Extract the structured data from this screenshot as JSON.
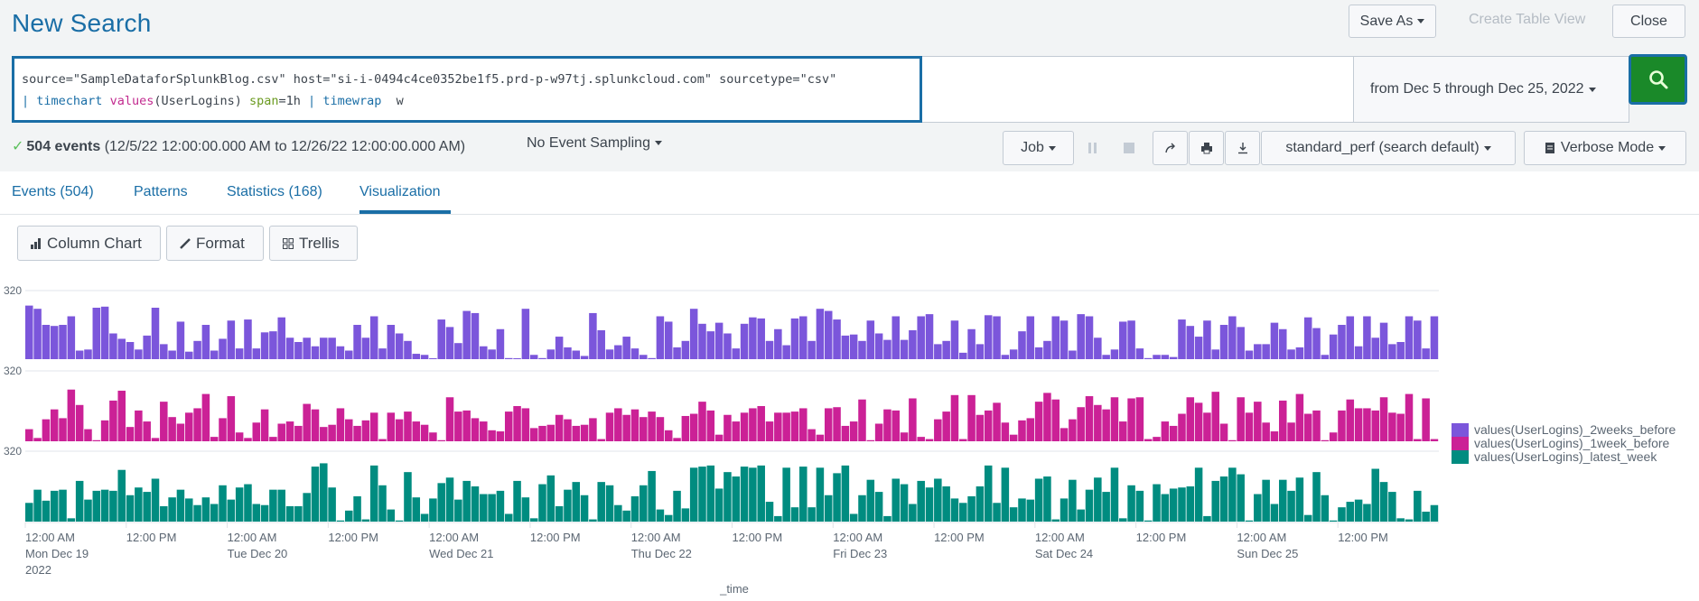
{
  "header": {
    "title": "New Search",
    "save_as_label": "Save As",
    "create_table_view_label": "Create Table View",
    "close_label": "Close"
  },
  "search": {
    "line1": {
      "source_key": "source=",
      "source_val": "\"SampleDataforSplunkBlog.csv\"",
      "host_key": " host=",
      "host_val": "\"si-i-0494c4ce0352be1f5.prd-p-w97tj.splunkcloud.com\"",
      "sourcetype_key": " sourcetype=",
      "sourcetype_val": "\"csv\""
    },
    "line2": {
      "pipe1": "| ",
      "cmd1": "timechart",
      "fn": "values",
      "fn_arg": "(UserLogins) ",
      "span_key": "span",
      "span_val": "=1h ",
      "pipe2": "| ",
      "cmd2": "timewrap",
      "cmd2_arg": "  w"
    },
    "time_range": "from Dec 5 through Dec 25, 2022",
    "search_icon": "magnifier-icon"
  },
  "status": {
    "check_icon": "✓",
    "events_count": "504 events",
    "range": "(12/5/22 12:00:00.000 AM to 12/26/22 12:00:00.000 AM)",
    "sampling": "No Event Sampling"
  },
  "job_controls": {
    "job_label": "Job",
    "pause_icon": "pause-icon",
    "stop_icon": "stop-icon",
    "share_icon": "share-icon",
    "print_icon": "print-icon",
    "export_icon": "export-icon",
    "perf_label": "standard_perf (search default)",
    "mode_label": "Verbose Mode"
  },
  "tabs": [
    {
      "label": "Events (504)",
      "active": false
    },
    {
      "label": "Patterns",
      "active": false
    },
    {
      "label": "Statistics (168)",
      "active": false
    },
    {
      "label": "Visualization",
      "active": true
    }
  ],
  "viz_buttons": {
    "chart_type": "Column Chart",
    "format": "Format",
    "trellis": "Trellis"
  },
  "colors": {
    "accent": "#1a6ea6",
    "go_button": "#1a8929",
    "series_2weeks": "#7b56db",
    "series_1week": "#cb2196",
    "series_latest": "#008c80"
  },
  "chart_data": {
    "type": "bar",
    "layout": "stacked-panels",
    "xlabel": "_time",
    "ylabel": "",
    "ylim": [
      0,
      320
    ],
    "y_tick_labels": [
      "320",
      "320",
      "320"
    ],
    "grid": true,
    "legend_position": "right",
    "x_ticks": [
      {
        "hour": 0,
        "line1": "12:00 AM",
        "line2": "Mon Dec 19",
        "line3": "2022"
      },
      {
        "hour": 12,
        "line1": "12:00 PM",
        "line2": "",
        "line3": ""
      },
      {
        "hour": 24,
        "line1": "12:00 AM",
        "line2": "Tue Dec 20",
        "line3": ""
      },
      {
        "hour": 36,
        "line1": "12:00 PM",
        "line2": "",
        "line3": ""
      },
      {
        "hour": 48,
        "line1": "12:00 AM",
        "line2": "Wed Dec 21",
        "line3": ""
      },
      {
        "hour": 60,
        "line1": "12:00 PM",
        "line2": "",
        "line3": ""
      },
      {
        "hour": 72,
        "line1": "12:00 AM",
        "line2": "Thu Dec 22",
        "line3": ""
      },
      {
        "hour": 84,
        "line1": "12:00 PM",
        "line2": "",
        "line3": ""
      },
      {
        "hour": 96,
        "line1": "12:00 AM",
        "line2": "Fri Dec 23",
        "line3": ""
      },
      {
        "hour": 108,
        "line1": "12:00 PM",
        "line2": "",
        "line3": ""
      },
      {
        "hour": 120,
        "line1": "12:00 AM",
        "line2": "Sat Dec 24",
        "line3": ""
      },
      {
        "hour": 132,
        "line1": "12:00 PM",
        "line2": "",
        "line3": ""
      },
      {
        "hour": 144,
        "line1": "12:00 AM",
        "line2": "Sun Dec 25",
        "line3": ""
      },
      {
        "hour": 156,
        "line1": "12:00 PM",
        "line2": "",
        "line3": ""
      }
    ],
    "series": [
      {
        "name": "values(UserLogins)_2weeks_before",
        "color": "#7b56db",
        "values": [
          250,
          235,
          160,
          155,
          160,
          200,
          40,
          45,
          240,
          245,
          120,
          95,
          80,
          45,
          110,
          240,
          70,
          40,
          175,
          35,
          85,
          160,
          40,
          95,
          180,
          50,
          185,
          50,
          125,
          130,
          195,
          100,
          80,
          100,
          60,
          100,
          100,
          60,
          40,
          160,
          100,
          200,
          50,
          160,
          120,
          85,
          25,
          20,
          2,
          185,
          150,
          75,
          225,
          215,
          60,
          45,
          140,
          5,
          2,
          235,
          20,
          5,
          45,
          105,
          55,
          40,
          15,
          215,
          135,
          45,
          65,
          105,
          50,
          20,
          5,
          200,
          175,
          55,
          85,
          235,
          165,
          130,
          170,
          120,
          50,
          165,
          195,
          190,
          85,
          140,
          65,
          190,
          200,
          85,
          235,
          225,
          185,
          110,
          115,
          85,
          180,
          120,
          90,
          200,
          90,
          135,
          200,
          210,
          70,
          85,
          180,
          30,
          140,
          70,
          205,
          200,
          20,
          45,
          130,
          200,
          55,
          85,
          200,
          180,
          40,
          210,
          200,
          100,
          20,
          45,
          175,
          180,
          50,
          5,
          20,
          20,
          10,
          185,
          155,
          105,
          180,
          45,
          160,
          200,
          150,
          40,
          70,
          70,
          170,
          140,
          45,
          55,
          195,
          145,
          20,
          115,
          160,
          200,
          60,
          200,
          100,
          170,
          70,
          80,
          200,
          180,
          50,
          200
        ]
      },
      {
        "name": "values(UserLogins)_1week_before",
        "color": "#cb2196",
        "values": [
          55,
          15,
          100,
          145,
          105,
          235,
          165,
          55,
          5,
          95,
          185,
          230,
          65,
          140,
          90,
          15,
          180,
          110,
          80,
          130,
          150,
          215,
          20,
          105,
          205,
          40,
          15,
          85,
          145,
          20,
          80,
          90,
          70,
          170,
          145,
          65,
          75,
          150,
          100,
          70,
          95,
          130,
          10,
          130,
          100,
          135,
          90,
          75,
          40,
          5,
          200,
          135,
          140,
          105,
          90,
          50,
          45,
          135,
          160,
          150,
          60,
          70,
          75,
          120,
          100,
          70,
          75,
          105,
          10,
          130,
          150,
          120,
          145,
          110,
          135,
          110,
          50,
          15,
          115,
          125,
          180,
          140,
          30,
          120,
          90,
          130,
          150,
          160,
          90,
          130,
          130,
          135,
          150,
          55,
          30,
          150,
          155,
          70,
          90,
          190,
          5,
          80,
          145,
          140,
          40,
          195,
          20,
          10,
          100,
          135,
          210,
          10,
          210,
          120,
          140,
          175,
          85,
          30,
          95,
          105,
          180,
          220,
          190,
          60,
          100,
          155,
          205,
          165,
          145,
          200,
          90,
          195,
          200,
          10,
          20,
          90,
          70,
          125,
          200,
          175,
          130,
          225,
          80,
          5,
          200,
          130,
          180,
          85,
          45,
          185,
          85,
          215,
          125,
          140,
          5,
          40,
          140,
          190,
          150,
          150,
          140,
          200,
          130,
          125,
          215,
          10,
          195,
          10
        ]
      },
      {
        "name": "values(UserLogins)_latest_week",
        "color": "#008c80",
        "values": [
          85,
          145,
          95,
          140,
          145,
          15,
          185,
          100,
          140,
          145,
          140,
          235,
          120,
          155,
          135,
          195,
          70,
          110,
          145,
          105,
          75,
          110,
          80,
          165,
          100,
          155,
          170,
          80,
          75,
          145,
          145,
          70,
          70,
          130,
          250,
          265,
          155,
          5,
          50,
          115,
          10,
          255,
          165,
          55,
          5,
          225,
          110,
          35,
          105,
          175,
          200,
          100,
          185,
          160,
          125,
          125,
          140,
          35,
          185,
          110,
          15,
          170,
          210,
          70,
          145,
          180,
          120,
          10,
          180,
          165,
          75,
          50,
          115,
          165,
          230,
          55,
          30,
          140,
          60,
          245,
          250,
          255,
          150,
          225,
          205,
          250,
          245,
          255,
          90,
          25,
          245,
          65,
          250,
          65,
          245,
          120,
          220,
          255,
          35,
          120,
          190,
          135,
          25,
          195,
          170,
          80,
          185,
          155,
          195,
          160,
          105,
          85,
          115,
          160,
          255,
          85,
          245,
          65,
          105,
          100,
          195,
          205,
          10,
          105,
          190,
          55,
          145,
          200,
          135,
          245,
          15,
          165,
          140,
          5,
          170,
          125,
          150,
          155,
          160,
          245,
          25,
          185,
          205,
          245,
          215,
          5,
          125,
          190,
          80,
          190,
          140,
          200,
          30,
          225,
          120,
          5,
          65,
          90,
          100,
          80,
          240,
          180,
          135,
          15,
          10,
          140,
          45,
          75
        ]
      }
    ]
  }
}
